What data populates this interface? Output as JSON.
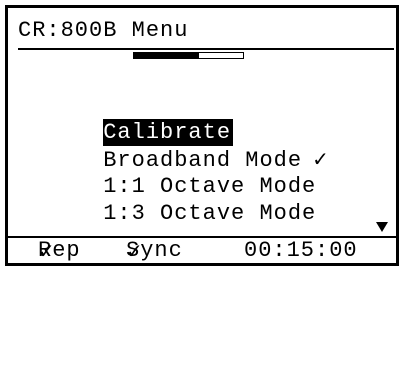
{
  "title": "CR:800B Menu",
  "scroll_position": 0.6,
  "menu": [
    {
      "label": "Calibrate",
      "selected": true,
      "checked": false
    },
    {
      "label": "Broadband Mode",
      "selected": false,
      "checked": true
    },
    {
      "label": "1:1 Octave Mode",
      "selected": false,
      "checked": false
    },
    {
      "label": "1:3 Octave Mode",
      "selected": false,
      "checked": false
    }
  ],
  "status": {
    "rep_label": "Rep",
    "sync_label": "Sync",
    "check_glyph": "✓",
    "timer": "00:15:00"
  }
}
